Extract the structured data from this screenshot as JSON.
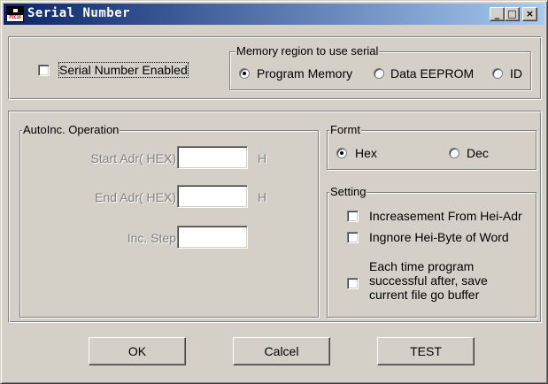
{
  "window": {
    "title": "Serial Number",
    "icon_text": "PIC16",
    "controls": {
      "minimize": "_",
      "maximize": "□",
      "close": "×"
    }
  },
  "serial": {
    "enabled_label": "Serial Number Enabled",
    "enabled_checked": false,
    "memory_region": {
      "legend": "Memory region to use serial",
      "options": [
        "Program Memory",
        "Data EEPROM",
        "ID"
      ],
      "selected": "Program Memory"
    }
  },
  "autoinc": {
    "legend": "AutoInc. Operation",
    "start_label": "Start Adr( HEX)",
    "start_unit": "H",
    "start_value": "",
    "end_label": "End Adr( HEX)",
    "end_unit": "H",
    "end_value": "",
    "step_label": "Inc. Step",
    "step_value": ""
  },
  "format": {
    "legend": "Formt",
    "options": [
      "Hex",
      "Dec"
    ],
    "selected": "Hex"
  },
  "setting": {
    "legend": "Setting",
    "options": [
      {
        "label": "Increasement From Hei-Adr",
        "checked": false
      },
      {
        "label": "Ingnore Hei-Byte of Word",
        "checked": false
      },
      {
        "label_lines": [
          "Each time program",
          "successful after, save",
          "current file go buffer"
        ],
        "checked": false
      }
    ]
  },
  "buttons": {
    "ok": "OK",
    "cancel": "Calcel",
    "test": "TEST"
  }
}
